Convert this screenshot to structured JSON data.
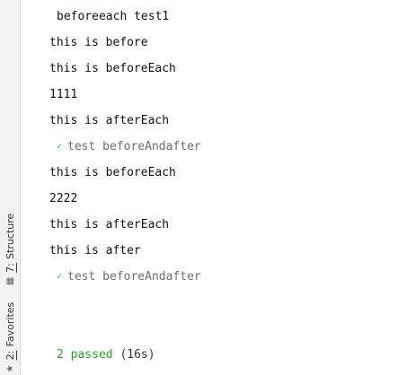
{
  "side_panel": {
    "structure_tab": {
      "number": "7:",
      "label": "Structure"
    },
    "favorites_tab": {
      "number": "2:",
      "label": "Favorites"
    }
  },
  "console": {
    "header": "beforeeach test1",
    "lines": [
      {
        "text": "this is before"
      },
      {
        "text": "this is beforeEach"
      },
      {
        "text": "1111"
      },
      {
        "text": "this is afterEach"
      },
      {
        "text": "test beforeAndafter",
        "status": "pass"
      },
      {
        "text": "this is beforeEach"
      },
      {
        "text": "2222"
      },
      {
        "text": "this is afterEach"
      },
      {
        "text": "this is after"
      },
      {
        "text": "test beforeAndafter",
        "status": "pass"
      }
    ],
    "summary": {
      "passed": "2 passed",
      "duration": "(16s)"
    }
  },
  "colors": {
    "pass_green": "#2aa52a",
    "muted_text": "#6e6e6e",
    "strip_bg": "#f2f2f2"
  }
}
